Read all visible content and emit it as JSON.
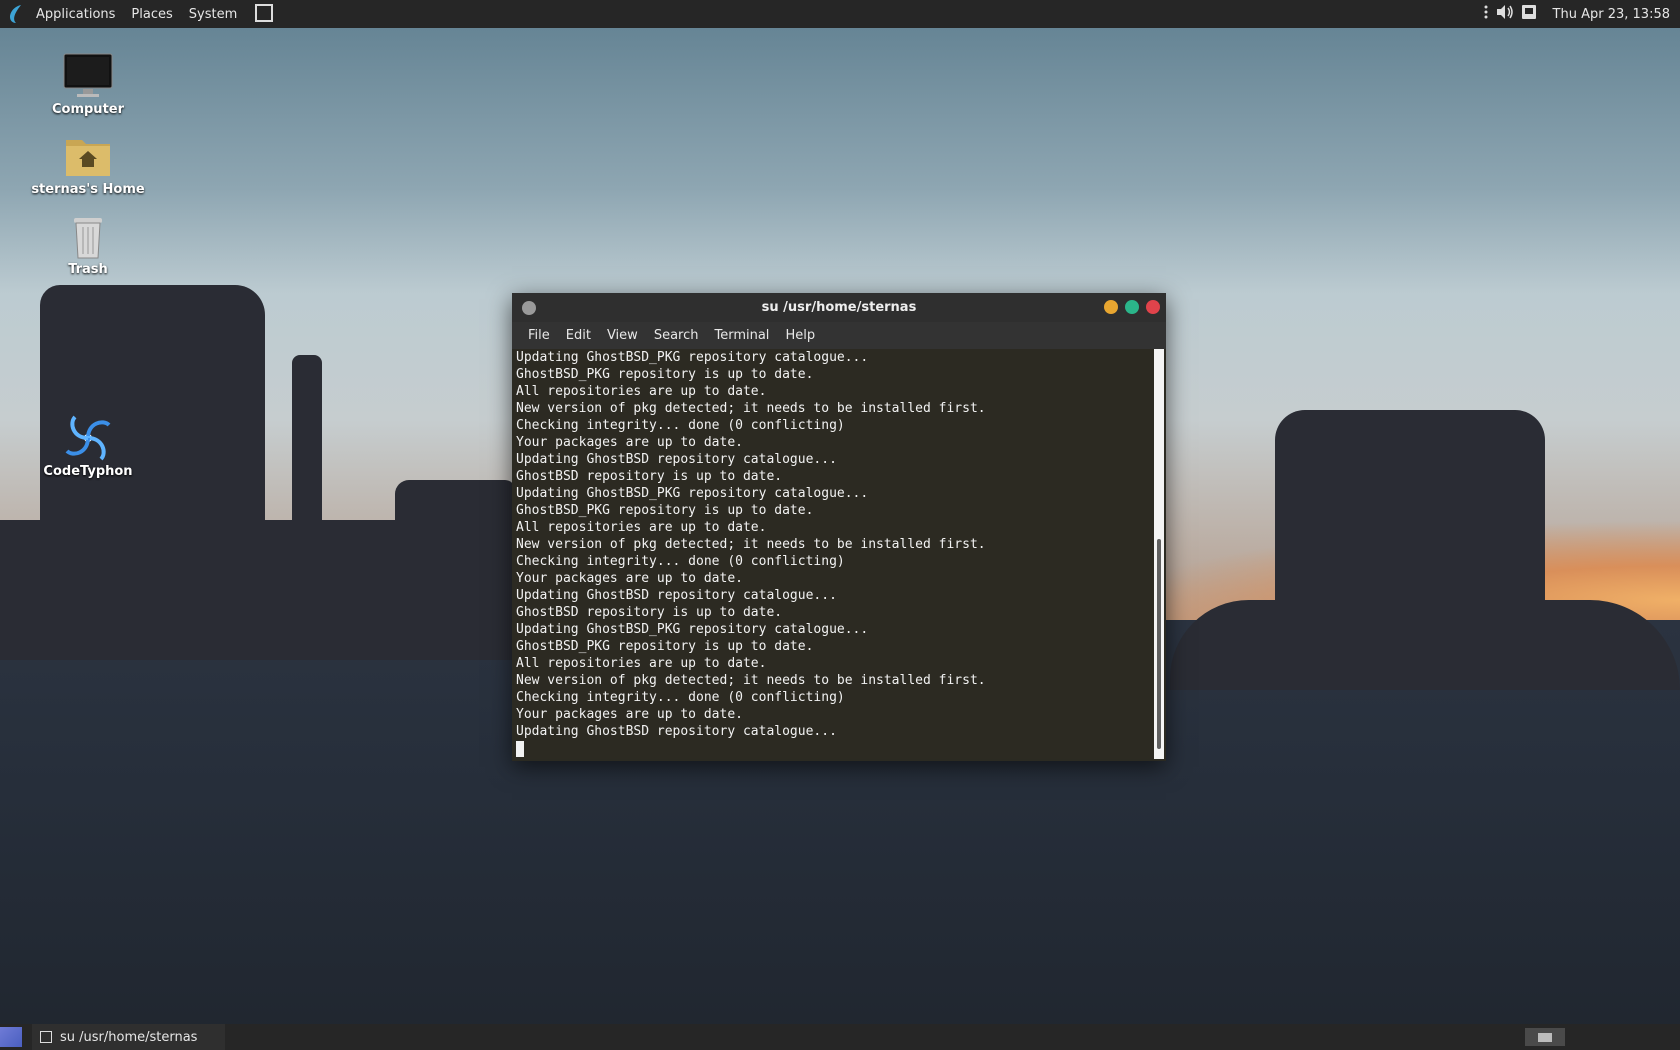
{
  "top_panel": {
    "menus": [
      "Applications",
      "Places",
      "System"
    ],
    "clock": "Thu Apr 23, 13:58",
    "tray_icons": [
      "more-icon",
      "volume-icon",
      "notification-icon"
    ]
  },
  "desktop": {
    "icons": [
      {
        "label": "Computer",
        "icon": "monitor-icon"
      },
      {
        "label": "sternas's Home",
        "icon": "home-folder-icon"
      },
      {
        "label": "Trash",
        "icon": "trash-icon"
      },
      {
        "label": "CodeTyphon",
        "icon": "codetyphon-icon"
      }
    ]
  },
  "window": {
    "title": "su /usr/home/sternas",
    "menu": [
      "File",
      "Edit",
      "View",
      "Search",
      "Terminal",
      "Help"
    ],
    "lines": [
      "Updating GhostBSD_PKG repository catalogue...",
      "GhostBSD_PKG repository is up to date.",
      "All repositories are up to date.",
      "New version of pkg detected; it needs to be installed first.",
      "Checking integrity... done (0 conflicting)",
      "Your packages are up to date.",
      "Updating GhostBSD repository catalogue...",
      "GhostBSD repository is up to date.",
      "Updating GhostBSD_PKG repository catalogue...",
      "GhostBSD_PKG repository is up to date.",
      "All repositories are up to date.",
      "New version of pkg detected; it needs to be installed first.",
      "Checking integrity... done (0 conflicting)",
      "Your packages are up to date.",
      "Updating GhostBSD repository catalogue...",
      "GhostBSD repository is up to date.",
      "Updating GhostBSD_PKG repository catalogue...",
      "GhostBSD_PKG repository is up to date.",
      "All repositories are up to date.",
      "New version of pkg detected; it needs to be installed first.",
      "Checking integrity... done (0 conflicting)",
      "Your packages are up to date.",
      "Updating GhostBSD repository catalogue..."
    ],
    "buttons": {
      "minimize_color": "#e8a630",
      "maximize_color": "#2bb58a",
      "close_color": "#e0434b"
    }
  },
  "bottom_panel": {
    "task_label": "su /usr/home/sternas"
  }
}
